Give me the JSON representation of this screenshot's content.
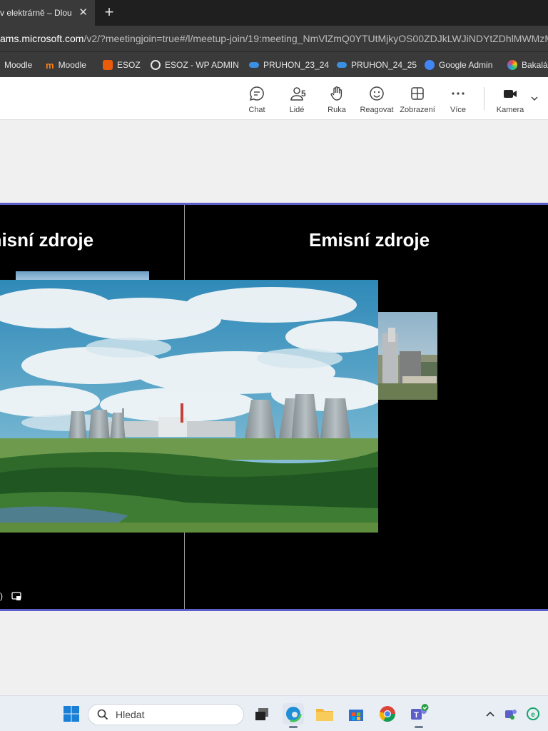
{
  "browser": {
    "tab_title": "v elektrárně – Dlou",
    "tab_close": "✕",
    "new_tab": "+",
    "url_host": "ams.microsoft.com",
    "url_path": "/v2/?meetingjoin=true#/l/meetup-join/19:meeting_NmVlZmQ0YTUtMjkyOS00ZDJkLWJiNDYtZDhlMWMzM",
    "bookmarks": [
      {
        "label": "Moodle",
        "icon": "moodle-icon",
        "color": "#e8892a"
      },
      {
        "label": "Moodle",
        "icon": "moodle-icon",
        "color": "#f98012"
      },
      {
        "label": "ESOZ",
        "icon": "office-icon",
        "color": "#ea5b0c"
      },
      {
        "label": "ESOZ - WP ADMIN",
        "icon": "wordpress-icon",
        "color": "#e6e6e6"
      },
      {
        "label": "PRUHON_23_24",
        "icon": "onedrive-icon",
        "color": "#3b8fe0"
      },
      {
        "label": "PRUHON_24_25",
        "icon": "onedrive-icon",
        "color": "#3b8fe0"
      },
      {
        "label": "Google Admin",
        "icon": "google-admin-icon",
        "color": "#4285f4"
      },
      {
        "label": "Bakalá",
        "icon": "bakalari-icon",
        "color": "#c44fd1"
      }
    ]
  },
  "toolbar": {
    "chat": "Chat",
    "people": "Lidé",
    "people_count": "5",
    "raise_hand": "Ruka",
    "react": "Reagovat",
    "view": "Zobrazení",
    "more": "Více",
    "camera": "Kamera"
  },
  "slides": {
    "left_title": "Emisní zdroje",
    "right_title": "Emisní zdroje"
  },
  "taskbar": {
    "search_placeholder": "Hledat"
  },
  "colors": {
    "accent": "#5b5fc7",
    "toolbar_bg": "#ffffff",
    "browser_chrome": "#3a3a3a"
  }
}
